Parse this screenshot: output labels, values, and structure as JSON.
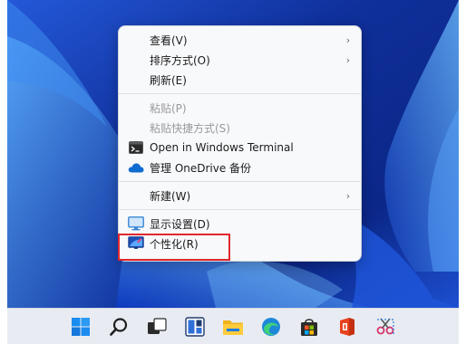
{
  "context_menu": {
    "items": [
      {
        "label": "查看(V)",
        "has_submenu": true,
        "disabled": false
      },
      {
        "label": "排序方式(O)",
        "has_submenu": true,
        "disabled": false
      },
      {
        "label": "刷新(E)",
        "has_submenu": false,
        "disabled": false
      },
      {
        "label": "粘贴(P)",
        "has_submenu": false,
        "disabled": true
      },
      {
        "label": "粘贴快捷方式(S)",
        "has_submenu": false,
        "disabled": true
      },
      {
        "label": "Open in Windows Terminal",
        "icon": "terminal-icon",
        "has_submenu": false,
        "disabled": false
      },
      {
        "label": "管理 OneDrive 备份",
        "icon": "onedrive-icon",
        "has_submenu": false,
        "disabled": false
      },
      {
        "label": "新建(W)",
        "has_submenu": true,
        "disabled": false
      },
      {
        "label": "显示设置(D)",
        "icon": "display-icon",
        "has_submenu": false,
        "disabled": false
      },
      {
        "label": "个性化(R)",
        "icon": "personalize-icon",
        "has_submenu": false,
        "disabled": false,
        "highlighted": true
      }
    ],
    "chevron": "›"
  },
  "taskbar": {
    "icons": [
      "start-icon",
      "search-icon",
      "task-view-icon",
      "widgets-icon",
      "file-explorer-icon",
      "edge-icon",
      "store-icon",
      "office-icon",
      "snipping-tool-icon"
    ]
  },
  "colors": {
    "highlight_box": "#e0272d",
    "wallpaper_base": "#0d2a8f",
    "taskbar_bg": "#e8ecf2"
  }
}
